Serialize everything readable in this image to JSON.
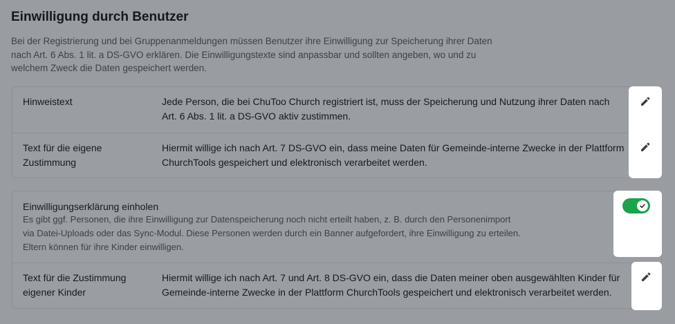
{
  "section": {
    "title": "Einwilligung durch Benutzer",
    "description": "Bei der Registrierung und bei Gruppenanmeldungen müssen Benutzer ihre Einwilligung zur Speicherung ihrer Daten nach Art. 6 Abs. 1 lit. a DS-GVO erklären. Die Einwilligungstexte sind anpassbar und sollten angeben, wo und zu welchem Zweck die Daten gespeichert werden."
  },
  "card1": {
    "rows": [
      {
        "label": "Hinweistext",
        "value": "Jede Person, die bei ChuToo Church registriert ist, muss der Speicherung und Nutzung ihrer Daten nach Art. 6 Abs. 1 lit. a DS-GVO aktiv zustimmen.",
        "action_icon": "pencil-icon"
      },
      {
        "label": "Text für die eigene Zustimmung",
        "value": "Hiermit willige ich nach Art. 7 DS-GVO ein, dass meine Daten für Gemeinde-interne Zwecke in der Plattform ChurchTools gespeichert und elektronisch verarbeitet werden.",
        "action_icon": "pencil-icon"
      }
    ]
  },
  "card2": {
    "consent": {
      "title": "Einwilligungserklärung einholen",
      "text": "Es gibt ggf. Personen, die ihre Einwilligung zur Datenspeicherung noch nicht erteilt haben, z. B. durch den Personenimport via Datei-Uploads oder das Sync-Modul. Diese Personen werden durch ein Banner aufgefordert, ihre Einwilligung zu erteilen. Eltern können für ihre Kinder einwilligen.",
      "toggle_on": true,
      "toggle_color": "#1aa34a"
    },
    "children_row": {
      "label": "Text für die Zustimmung eigener Kinder",
      "value": "Hiermit willige ich nach Art. 7 und Art. 8 DS-GVO ein, dass die Daten meiner oben ausgewählten Kinder für Gemeinde-interne Zwecke in der Plattform ChurchTools gespeichert und elektronisch verarbeitet werden.",
      "action_icon": "pencil-icon"
    }
  },
  "colors": {
    "overlay_background": "#999ca1",
    "highlight_panel": "#ffffff",
    "toggle_on": "#1aa34a"
  }
}
